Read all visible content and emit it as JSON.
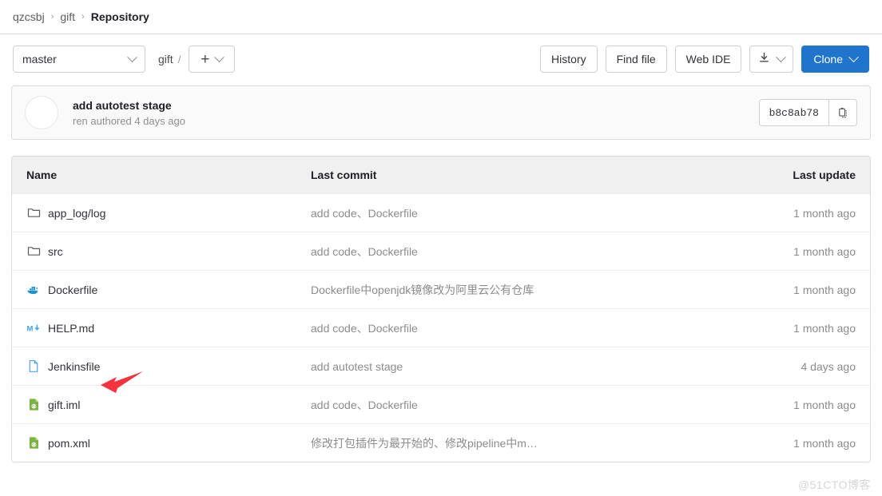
{
  "breadcrumb": {
    "items": [
      {
        "label": "qzcsbj",
        "current": false
      },
      {
        "label": "gift",
        "current": false
      },
      {
        "label": "Repository",
        "current": true
      }
    ],
    "separator": "›"
  },
  "toolbar": {
    "branch": "master",
    "path": "gift",
    "path_separator": "/",
    "add_label": "+",
    "history_label": "History",
    "find_file_label": "Find file",
    "web_ide_label": "Web IDE",
    "download_icon": "download-icon",
    "clone_label": "Clone",
    "clone_color": "#1f75cb"
  },
  "last_commit": {
    "avatar": "avatar-placeholder",
    "title": "add autotest stage",
    "subtitle": "ren authored 4 days ago",
    "sha": "b8c8ab78",
    "copy_icon": "clipboard-icon"
  },
  "file_table": {
    "headers": {
      "name": "Name",
      "last_commit": "Last commit",
      "last_update": "Last update"
    },
    "rows": [
      {
        "icon": "folder-icon",
        "name": "app_log/log",
        "last_commit": "add code、Dockerfile",
        "last_update": "1 month ago"
      },
      {
        "icon": "folder-icon",
        "name": "src",
        "last_commit": "add code、Dockerfile",
        "last_update": "1 month ago"
      },
      {
        "icon": "docker-icon",
        "name": "Dockerfile",
        "last_commit": "Dockerfile中openjdk镜像改为阿里云公有仓库",
        "last_update": "1 month ago"
      },
      {
        "icon": "markdown-icon",
        "name": "HELP.md",
        "last_commit": "add code、Dockerfile",
        "last_update": "1 month ago"
      },
      {
        "icon": "document-icon",
        "name": "Jenkinsfile",
        "last_commit": "add autotest stage",
        "last_update": "4 days ago"
      },
      {
        "icon": "xml-file-icon",
        "name": "gift.iml",
        "last_commit": "add code、Dockerfile",
        "last_update": "1 month ago"
      },
      {
        "icon": "xml-file-icon",
        "name": "pom.xml",
        "last_commit": "修改打包插件为最开始的、修改pipeline中m…",
        "last_update": "1 month ago"
      }
    ]
  },
  "annotation": {
    "arrow_color": "#f5333f",
    "points_at": "Jenkinsfile"
  },
  "watermark": {
    "text": "@51CTO博客"
  }
}
